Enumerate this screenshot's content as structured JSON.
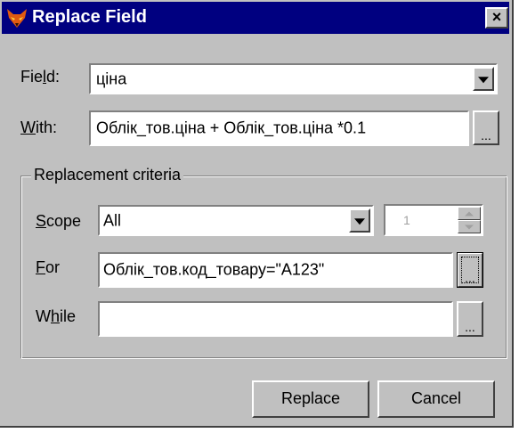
{
  "dialog": {
    "title": "Replace Field",
    "close_label": "×"
  },
  "field": {
    "label": "Field:",
    "value": "ціна"
  },
  "with": {
    "label": "With:",
    "value": "Облік_тов.ціна + Облік_тов.ціна *0.1",
    "builder_label": "..."
  },
  "criteria": {
    "title": "Replacement criteria",
    "scope": {
      "label": "Scope",
      "value": "All",
      "spin_value": "1"
    },
    "for": {
      "label": "For",
      "value": "Облік_тов.код_товару=\"A123\"",
      "builder_label": "..."
    },
    "while": {
      "label": "While",
      "value": "",
      "builder_label": "..."
    }
  },
  "buttons": {
    "replace": "Replace",
    "cancel": "Cancel"
  },
  "colors": {
    "titlebar": "#000080",
    "face": "#c0c0c0"
  }
}
